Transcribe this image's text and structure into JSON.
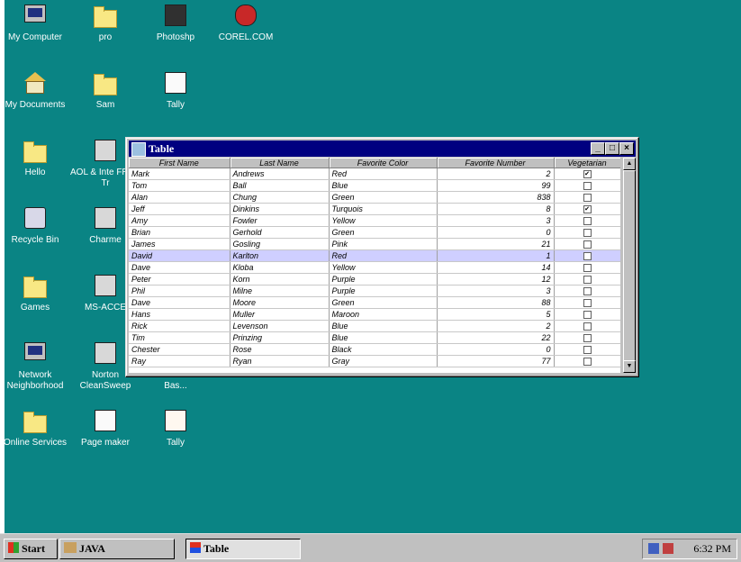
{
  "desktop_icons": [
    {
      "label": "My Computer",
      "icon": "my-computer-icon"
    },
    {
      "label": "pro",
      "icon": "folder-icon"
    },
    {
      "label": "Photoshp",
      "icon": "photoshop-icon"
    },
    {
      "label": "COREL.COM",
      "icon": "corel-icon"
    },
    {
      "label": "My Documents",
      "icon": "my-documents-icon"
    },
    {
      "label": "Sam",
      "icon": "folder-icon"
    },
    {
      "label": "Tally",
      "icon": "tally-doc-icon"
    },
    {
      "label": "Hello",
      "icon": "folder-icon"
    },
    {
      "label": "AOL & Inte FREE Tr",
      "icon": "aol-icon"
    },
    {
      "label": "Recycle Bin",
      "icon": "recycle-bin-icon"
    },
    {
      "label": "Charme",
      "icon": "charme-icon"
    },
    {
      "label": "Games",
      "icon": "folder-icon"
    },
    {
      "label": "MS-ACCE",
      "icon": "ms-access-icon"
    },
    {
      "label": "Network Neighborhood",
      "icon": "network-icon"
    },
    {
      "label": "Norton CleanSweep",
      "icon": "norton-icon"
    },
    {
      "label": "Microsoft Visual Bas...",
      "icon": "visual-basic-icon"
    },
    {
      "label": "Online Services",
      "icon": "folder-icon"
    },
    {
      "label": "Page maker",
      "icon": "pagemaker-icon"
    },
    {
      "label": "Tally",
      "icon": "tally-app-icon"
    }
  ],
  "window": {
    "title": "Table",
    "buttons": {
      "minimize": "_",
      "maximize": "□",
      "close": "×"
    },
    "columns": [
      "First Name",
      "Last Name",
      "Favorite Color",
      "Favorite Number",
      "Vegetarian"
    ],
    "selected_row": 8,
    "rows": [
      {
        "first": "Mark",
        "last": "Andrews",
        "color": "Red",
        "number": "2",
        "veg": true
      },
      {
        "first": "Tom",
        "last": "Ball",
        "color": "Blue",
        "number": "99",
        "veg": false
      },
      {
        "first": "Alan",
        "last": "Chung",
        "color": "Green",
        "number": "838",
        "veg": false
      },
      {
        "first": "Jeff",
        "last": "Dinkins",
        "color": "Turquois",
        "number": "8",
        "veg": true
      },
      {
        "first": "Amy",
        "last": "Fowler",
        "color": "Yellow",
        "number": "3",
        "veg": false
      },
      {
        "first": "Brian",
        "last": "Gerhold",
        "color": "Green",
        "number": "0",
        "veg": false
      },
      {
        "first": "James",
        "last": "Gosling",
        "color": "Pink",
        "number": "21",
        "veg": false
      },
      {
        "first": "David",
        "last": "Karlton",
        "color": "Red",
        "number": "1",
        "veg": false
      },
      {
        "first": "Dave",
        "last": "Kloba",
        "color": "Yellow",
        "number": "14",
        "veg": false
      },
      {
        "first": "Peter",
        "last": "Korn",
        "color": "Purple",
        "number": "12",
        "veg": false
      },
      {
        "first": "Phil",
        "last": "Milne",
        "color": "Purple",
        "number": "3",
        "veg": false
      },
      {
        "first": "Dave",
        "last": "Moore",
        "color": "Green",
        "number": "88",
        "veg": false
      },
      {
        "first": "Hans",
        "last": "Muller",
        "color": "Maroon",
        "number": "5",
        "veg": false
      },
      {
        "first": "Rick",
        "last": "Levenson",
        "color": "Blue",
        "number": "2",
        "veg": false
      },
      {
        "first": "Tim",
        "last": "Prinzing",
        "color": "Blue",
        "number": "22",
        "veg": false
      },
      {
        "first": "Chester",
        "last": "Rose",
        "color": "Black",
        "number": "0",
        "veg": false
      },
      {
        "first": "Ray",
        "last": "Ryan",
        "color": "Gray",
        "number": "77",
        "veg": false
      }
    ]
  },
  "taskbar": {
    "start_label": "Start",
    "tasks": [
      {
        "label": "JAVA",
        "pressed": false
      },
      {
        "label": "Table",
        "pressed": true
      }
    ],
    "clock": "6:32 PM"
  }
}
